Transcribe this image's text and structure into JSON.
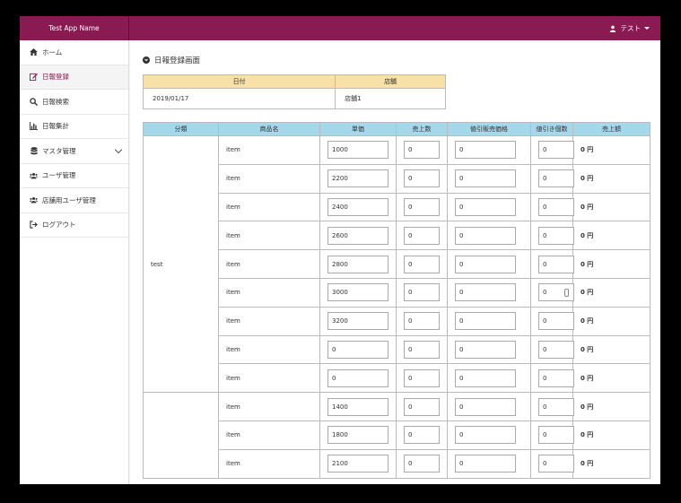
{
  "app": {
    "name": "Test App Name",
    "user": "テスト"
  },
  "sidebar": {
    "items": [
      {
        "label": "ホーム",
        "icon": "home-icon"
      },
      {
        "label": "日報登録",
        "icon": "edit-icon"
      },
      {
        "label": "日報検索",
        "icon": "search-icon"
      },
      {
        "label": "日報集計",
        "icon": "chart-icon"
      },
      {
        "label": "マスタ管理",
        "icon": "database-icon"
      },
      {
        "label": "ユーザ管理",
        "icon": "users-icon"
      },
      {
        "label": "店舗用ユーザ管理",
        "icon": "users-icon"
      },
      {
        "label": "ログアウト",
        "icon": "logout-icon"
      }
    ]
  },
  "page": {
    "title": "日報登録画面"
  },
  "info": {
    "headers": [
      "日付",
      "店舗"
    ],
    "date": "2019/01/17",
    "store": "店舗1"
  },
  "table": {
    "headers": [
      "分類",
      "商品名",
      "単価",
      "売上数",
      "値引販売価格",
      "値引き個数",
      "売上額"
    ],
    "groups": [
      {
        "category": "test",
        "rows": [
          {
            "name": "item",
            "price": "1000",
            "qty": "0",
            "disc_price": "0",
            "disc_qty": "0",
            "amount": "0 円"
          },
          {
            "name": "item",
            "price": "2200",
            "qty": "0",
            "disc_price": "0",
            "disc_qty": "0",
            "amount": "0 円"
          },
          {
            "name": "item",
            "price": "2400",
            "qty": "0",
            "disc_price": "0",
            "disc_qty": "0",
            "amount": "0 円"
          },
          {
            "name": "item",
            "price": "2600",
            "qty": "0",
            "disc_price": "0",
            "disc_qty": "0",
            "amount": "0 円"
          },
          {
            "name": "item",
            "price": "2800",
            "qty": "0",
            "disc_price": "0",
            "disc_qty": "0",
            "amount": "0 円"
          },
          {
            "name": "item",
            "price": "3000",
            "qty": "0",
            "disc_price": "0",
            "disc_qty": "0",
            "amount": "0 円"
          },
          {
            "name": "item",
            "price": "3200",
            "qty": "0",
            "disc_price": "0",
            "disc_qty": "0",
            "amount": "0 円"
          },
          {
            "name": "item",
            "price": "0",
            "qty": "0",
            "disc_price": "0",
            "disc_qty": "0",
            "amount": "0 円"
          },
          {
            "name": "item",
            "price": "0",
            "qty": "0",
            "disc_price": "0",
            "disc_qty": "0",
            "amount": "0 円"
          }
        ]
      },
      {
        "category": "",
        "rows": [
          {
            "name": "item",
            "price": "1400",
            "qty": "0",
            "disc_price": "0",
            "disc_qty": "0",
            "amount": "0 円"
          },
          {
            "name": "item",
            "price": "1800",
            "qty": "0",
            "disc_price": "0",
            "disc_qty": "0",
            "amount": "0 円"
          },
          {
            "name": "item",
            "price": "2100",
            "qty": "0",
            "disc_price": "0",
            "disc_qty": "0",
            "amount": "0 円"
          }
        ]
      }
    ]
  },
  "colors": {
    "brand": "#8a1b52",
    "info_header": "#f7e1a6",
    "table_header": "#a6d8ec"
  }
}
